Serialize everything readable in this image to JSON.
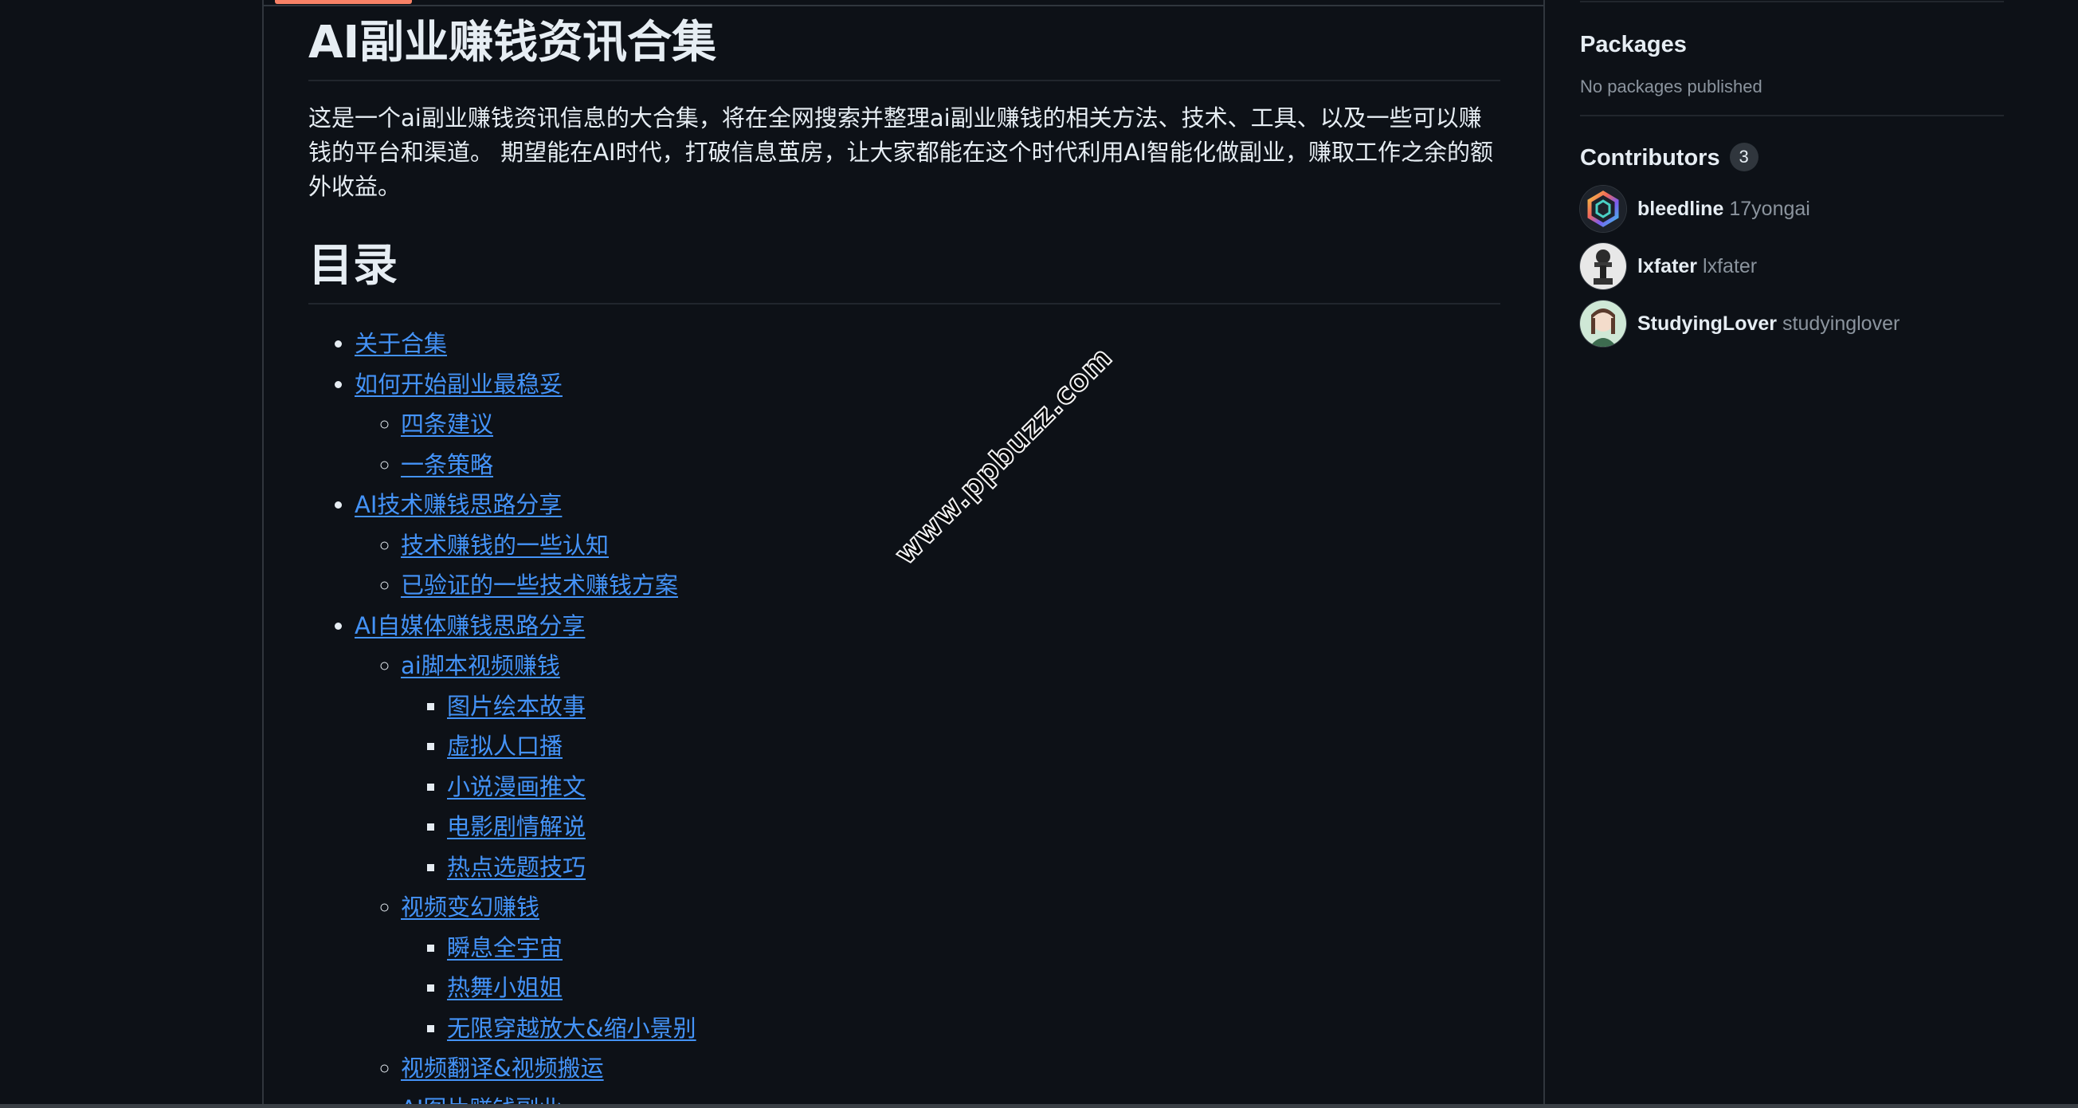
{
  "readme": {
    "title": "AI副业赚钱资讯合集",
    "intro": "这是一个ai副业赚钱资讯信息的大合集，将在全网搜索并整理ai副业赚钱的相关方法、技术、工具、以及一些可以赚钱的平台和渠道。 期望能在AI时代，打破信息茧房，让大家都能在这个时代利用AI智能化做副业，赚取工作之余的额外收益。",
    "toc_heading": "目录",
    "toc": [
      {
        "label": "关于合集",
        "children": []
      },
      {
        "label": "如何开始副业最稳妥",
        "children": [
          {
            "label": "四条建议",
            "children": []
          },
          {
            "label": "一条策略",
            "children": []
          }
        ]
      },
      {
        "label": "AI技术赚钱思路分享",
        "children": [
          {
            "label": "技术赚钱的一些认知",
            "children": []
          },
          {
            "label": "已验证的一些技术赚钱方案",
            "children": []
          }
        ]
      },
      {
        "label": "AI自媒体赚钱思路分享",
        "children": [
          {
            "label": "ai脚本视频赚钱",
            "children": [
              {
                "label": "图片绘本故事"
              },
              {
                "label": "虚拟人口播"
              },
              {
                "label": "小说漫画推文"
              },
              {
                "label": "电影剧情解说"
              },
              {
                "label": "热点选题技巧"
              }
            ]
          },
          {
            "label": "视频变幻赚钱",
            "children": [
              {
                "label": "瞬息全宇宙"
              },
              {
                "label": "热舞小姐姐"
              },
              {
                "label": "无限穿越放大&缩小景别"
              }
            ]
          },
          {
            "label": "视频翻译&视频搬运",
            "children": []
          },
          {
            "label": "AI图片赚钱副业",
            "children": []
          }
        ]
      }
    ]
  },
  "sidebar": {
    "packages_heading": "Packages",
    "packages_empty": "No packages published",
    "contributors_heading": "Contributors",
    "contributors_count": "3",
    "contributors": [
      {
        "name": "bleedline",
        "login": "17yongai",
        "avatar": "hexagon-logo"
      },
      {
        "name": "lxfater",
        "login": "lxfater",
        "avatar": "figure-avatar"
      },
      {
        "name": "StudyingLover",
        "login": "studyinglover",
        "avatar": "anime-avatar"
      }
    ]
  },
  "watermark": "www.ppbuzz.com",
  "colors": {
    "background": "#0d1117",
    "link": "#4493f8",
    "border": "#30363d",
    "muted": "#8b949e",
    "tab_accent": "#f78166"
  }
}
